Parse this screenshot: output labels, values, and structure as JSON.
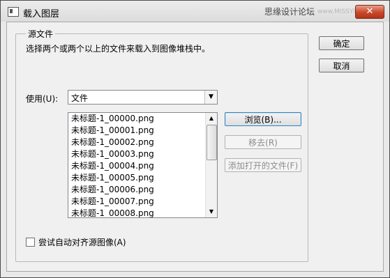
{
  "window": {
    "title": "载入图层"
  },
  "watermark": {
    "site_cn": "思缘设计论坛",
    "site_url": "www.MISSYUAN.COM"
  },
  "titlebar": {
    "close_glyph": "✕"
  },
  "source_group": {
    "label": "源文件",
    "description": "选择两个或两个以上的文件来载入到图像堆栈中。",
    "use_label": "使用(U):",
    "use_value": "文件",
    "files": [
      "未标题-1_00000.png",
      "未标题-1_00001.png",
      "未标题-1_00002.png",
      "未标题-1_00003.png",
      "未标题-1_00004.png",
      "未标题-1_00005.png",
      "未标题-1_00006.png",
      "未标题-1_00007.png",
      "未标题-1_00008.png"
    ],
    "browse_label": "浏览(B)...",
    "remove_label": "移去(R)",
    "add_open_label": "添加打开的文件(F)",
    "auto_align_label": "尝试自动对齐源图像(A)",
    "auto_align_checked": false
  },
  "buttons": {
    "ok_label": "确定",
    "cancel_label": "取消"
  },
  "icons": {
    "dropdown": "chevron-down-icon",
    "scroll_up": "scroll-up-arrow-icon",
    "scroll_down": "scroll-down-arrow-icon"
  }
}
